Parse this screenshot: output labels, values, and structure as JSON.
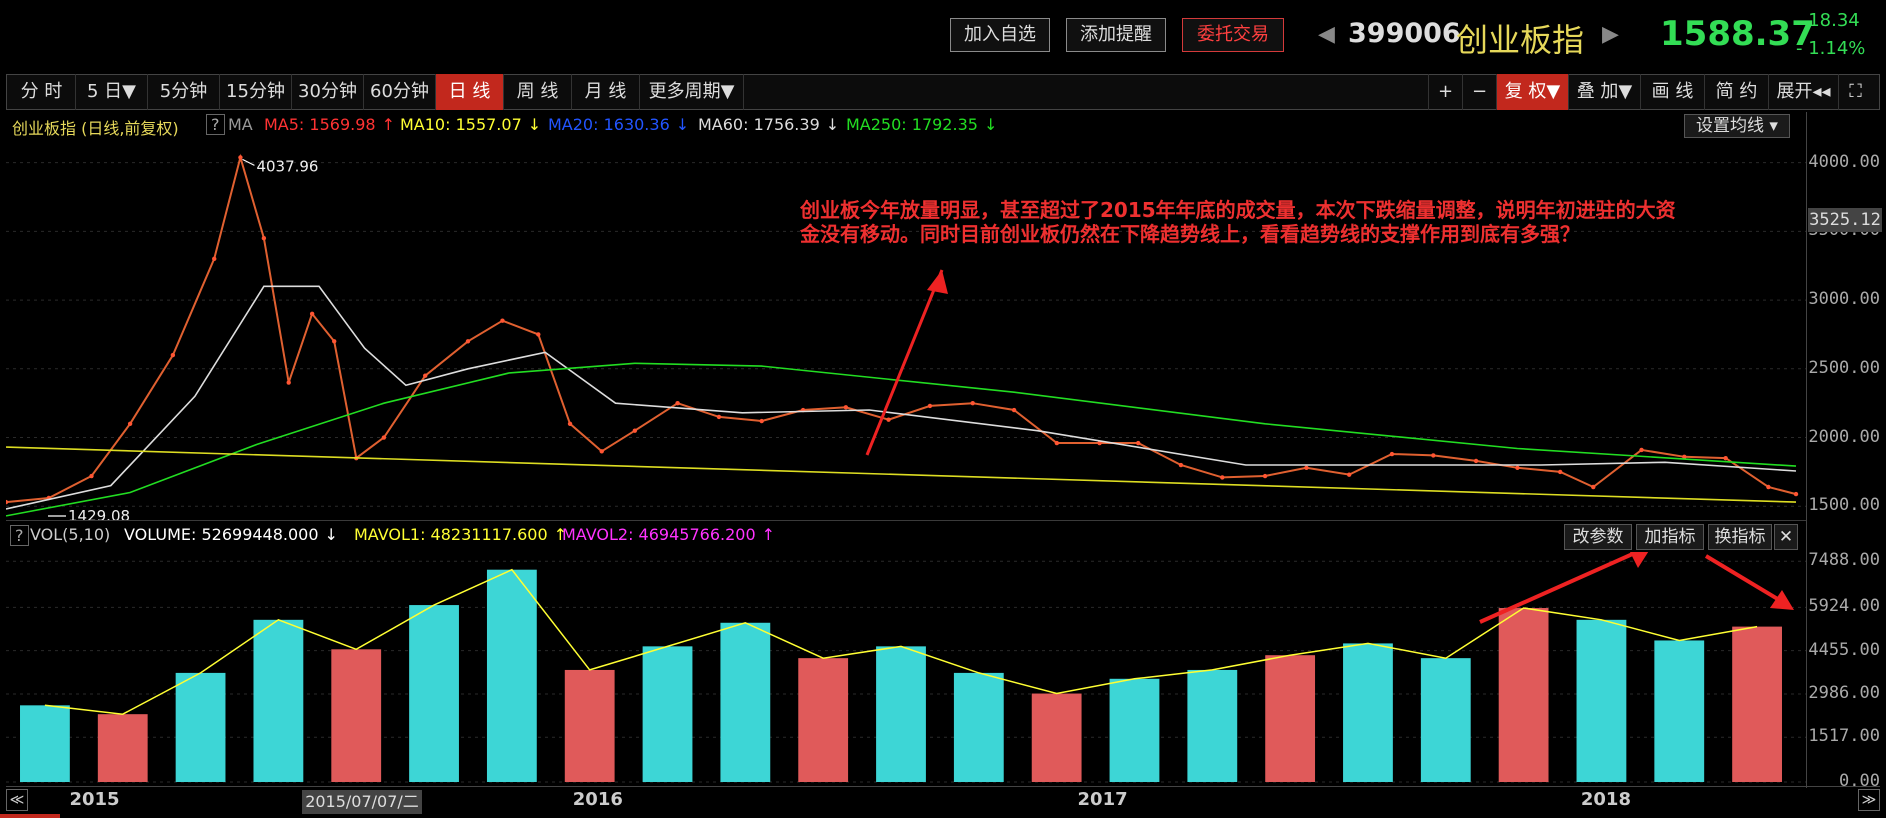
{
  "header": {
    "buttons": [
      "加入自选",
      "添加提醒",
      "委托交易"
    ],
    "code": "399006",
    "name": "创业板指",
    "price": "1588.37",
    "change": "- 18.34",
    "change_pct": "- 1.14%",
    "colors": {
      "price": "#33dd55",
      "accent": "#c2281d"
    }
  },
  "periods": [
    "分 时",
    "5 日▼",
    "5分钟",
    "15分钟",
    "30分钟",
    "60分钟",
    "日 线",
    "周 线",
    "月 线",
    "更多周期▼"
  ],
  "active_period": "日 线",
  "right_tools": [
    "+",
    "−",
    "复 权▼",
    "叠 加▼",
    "画 线",
    "简 约",
    "展开◂◂",
    "⛶"
  ],
  "ma_legend": {
    "title": "创业板指 (日线,前复权)",
    "help": "?",
    "ma_label": "MA",
    "items": [
      {
        "text": "MA5: 1569.98",
        "arrow": "↑",
        "color": "#ff3333"
      },
      {
        "text": "MA10: 1557.07",
        "arrow": "↓",
        "color": "#ffff33"
      },
      {
        "text": "MA20: 1630.36",
        "arrow": "↓",
        "color": "#2255ff"
      },
      {
        "text": "MA60: 1756.39",
        "arrow": "↓",
        "color": "#dddddd"
      },
      {
        "text": "MA250: 1792.35",
        "arrow": "↓",
        "color": "#22dd22"
      }
    ],
    "settings_btn": "设置均线 ▾"
  },
  "annotation": "创业板今年放量明显，甚至超过了2015年年底的成交量，本次下跌缩量调整，说明年初进驻的大资金没有移动。同时目前创业板仍然在下降趋势线上，看看趋势线的支撑作用到底有多强？",
  "vol_legend": {
    "help": "?",
    "items": [
      {
        "text": "VOL(5,10)",
        "arrow": "",
        "color": "#cccccc"
      },
      {
        "text": "VOLUME: 52699448.000",
        "arrow": "↓",
        "color": "#ffffff"
      },
      {
        "text": "MAVOL1: 48231117.600",
        "arrow": "↑",
        "color": "#ffff33"
      },
      {
        "text": "MAVOL2: 46945766.200",
        "arrow": "↑",
        "color": "#ff33ff"
      }
    ],
    "buttons": [
      "改参数",
      "加指标",
      "换指标",
      "✕"
    ]
  },
  "x_axis": {
    "labels": [
      "2015",
      "2016",
      "2017",
      "2018"
    ],
    "cursor_date": "2015/07/07/二",
    "scroll_left": "≪",
    "scroll_right": "≫"
  },
  "chart_data": [
    {
      "type": "line",
      "title": "创业板指 (日线,前复权)",
      "ylim": [
        1400,
        4150
      ],
      "y_ticks": [
        "4000.00",
        "3500.00",
        "3000.00",
        "2500.00",
        "2000.00",
        "1500.00"
      ],
      "current_price_label": "3525.12",
      "high_label": "4037.96",
      "low_label": "1429.08",
      "x_range": [
        "2014-12-15",
        "2018-07-05"
      ],
      "series": [
        {
          "name": "创业板指",
          "color": "#e06030",
          "x": [
            "2014-12-15",
            "2015-01-15",
            "2015-02-15",
            "2015-03-15",
            "2015-04-15",
            "2015-05-15",
            "2015-06-03",
            "2015-06-20",
            "2015-07-08",
            "2015-07-25",
            "2015-08-10",
            "2015-08-26",
            "2015-09-15",
            "2015-10-15",
            "2015-11-15",
            "2015-12-10",
            "2016-01-05",
            "2016-01-28",
            "2016-02-20",
            "2016-03-15",
            "2016-04-15",
            "2016-05-15",
            "2016-06-15",
            "2016-07-15",
            "2016-08-15",
            "2016-09-15",
            "2016-10-15",
            "2016-11-15",
            "2016-12-15",
            "2017-01-15",
            "2017-02-15",
            "2017-03-15",
            "2017-04-15",
            "2017-05-15",
            "2017-06-15",
            "2017-07-15",
            "2017-08-15",
            "2017-09-15",
            "2017-10-15",
            "2017-11-15",
            "2017-12-15",
            "2018-01-15",
            "2018-02-08",
            "2018-03-15",
            "2018-04-15",
            "2018-05-15",
            "2018-06-15",
            "2018-07-05"
          ],
          "y": [
            1530,
            1560,
            1720,
            2100,
            2600,
            3300,
            4037.96,
            3450,
            2400,
            2900,
            2700,
            1850,
            2000,
            2450,
            2700,
            2850,
            2750,
            2100,
            1900,
            2050,
            2250,
            2150,
            2120,
            2200,
            2220,
            2130,
            2230,
            2250,
            2200,
            1960,
            1960,
            1960,
            1800,
            1710,
            1720,
            1780,
            1730,
            1880,
            1870,
            1830,
            1780,
            1750,
            1640,
            1910,
            1860,
            1850,
            1640,
            1588.37
          ]
        },
        {
          "name": "MA60",
          "color": "#dddddd",
          "x": [
            "2014-12-15",
            "2015-03-01",
            "2015-05-01",
            "2015-06-20",
            "2015-07-30",
            "2015-09-01",
            "2015-10-01",
            "2015-11-15",
            "2016-01-10",
            "2016-03-01",
            "2016-06-01",
            "2016-09-01",
            "2017-01-01",
            "2017-06-01",
            "2017-09-01",
            "2018-01-01",
            "2018-04-01",
            "2018-07-05"
          ],
          "y": [
            1480,
            1650,
            2300,
            3100,
            3100,
            2650,
            2380,
            2500,
            2620,
            2250,
            2180,
            2200,
            2050,
            1800,
            1800,
            1800,
            1820,
            1756.39
          ]
        },
        {
          "name": "MA250",
          "color": "#22dd22",
          "x": [
            "2014-12-15",
            "2015-03-15",
            "2015-06-15",
            "2015-09-15",
            "2015-12-15",
            "2016-03-15",
            "2016-06-15",
            "2016-12-15",
            "2017-06-15",
            "2017-12-15",
            "2018-07-05"
          ],
          "y": [
            1430,
            1600,
            1950,
            2250,
            2470,
            2540,
            2520,
            2330,
            2100,
            1920,
            1792.35
          ]
        },
        {
          "name": "趋势线",
          "color": "#dddd22",
          "x": [
            "2014-12-15",
            "2018-07-05"
          ],
          "y": [
            1930,
            1530
          ]
        }
      ]
    },
    {
      "type": "bar",
      "title": "VOL(5,10)",
      "ylim": [
        0,
        7800
      ],
      "y_ticks": [
        "7488.00",
        "5924.00",
        "4455.00",
        "2986.00",
        "1517.00",
        "0.00"
      ],
      "x": [
        "2014-12",
        "2015-02",
        "2015-04",
        "2015-06",
        "2015-08",
        "2015-10",
        "2015-12",
        "2016-02",
        "2016-04",
        "2016-06",
        "2016-08",
        "2016-10",
        "2016-12",
        "2017-02",
        "2017-04",
        "2017-06",
        "2017-08",
        "2017-10",
        "2017-12",
        "2018-02",
        "2018-04",
        "2018-06",
        "2018-07"
      ],
      "values": [
        2600,
        2300,
        3700,
        5500,
        4500,
        6000,
        7200,
        3800,
        4600,
        5400,
        4200,
        4600,
        3700,
        3000,
        3500,
        3800,
        4300,
        4700,
        4200,
        5900,
        5500,
        4800,
        5270
      ]
    }
  ]
}
